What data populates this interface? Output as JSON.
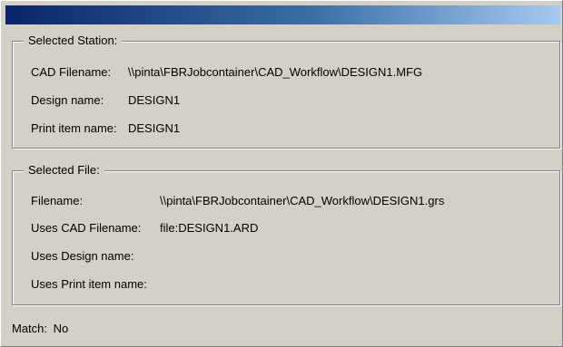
{
  "station": {
    "legend": "Selected Station:",
    "fields": [
      {
        "label": "CAD Filename:",
        "value": "\\\\pinta\\FBRJobcontainer\\CAD_Workflow\\DESIGN1.MFG"
      },
      {
        "label": "Design name:",
        "value": "DESIGN1"
      },
      {
        "label": "Print item name:",
        "value": "DESIGN1"
      }
    ]
  },
  "file": {
    "legend": "Selected File:",
    "fields": [
      {
        "label": "Filename:",
        "value": "\\\\pinta\\FBRJobcontainer\\CAD_Workflow\\DESIGN1.grs"
      },
      {
        "label": "Uses CAD Filename:",
        "value": "file:DESIGN1.ARD"
      },
      {
        "label": "Uses Design name:",
        "value": ""
      },
      {
        "label": "Uses Print item name:",
        "value": ""
      }
    ]
  },
  "match": {
    "label": "Match:",
    "value": "No"
  }
}
